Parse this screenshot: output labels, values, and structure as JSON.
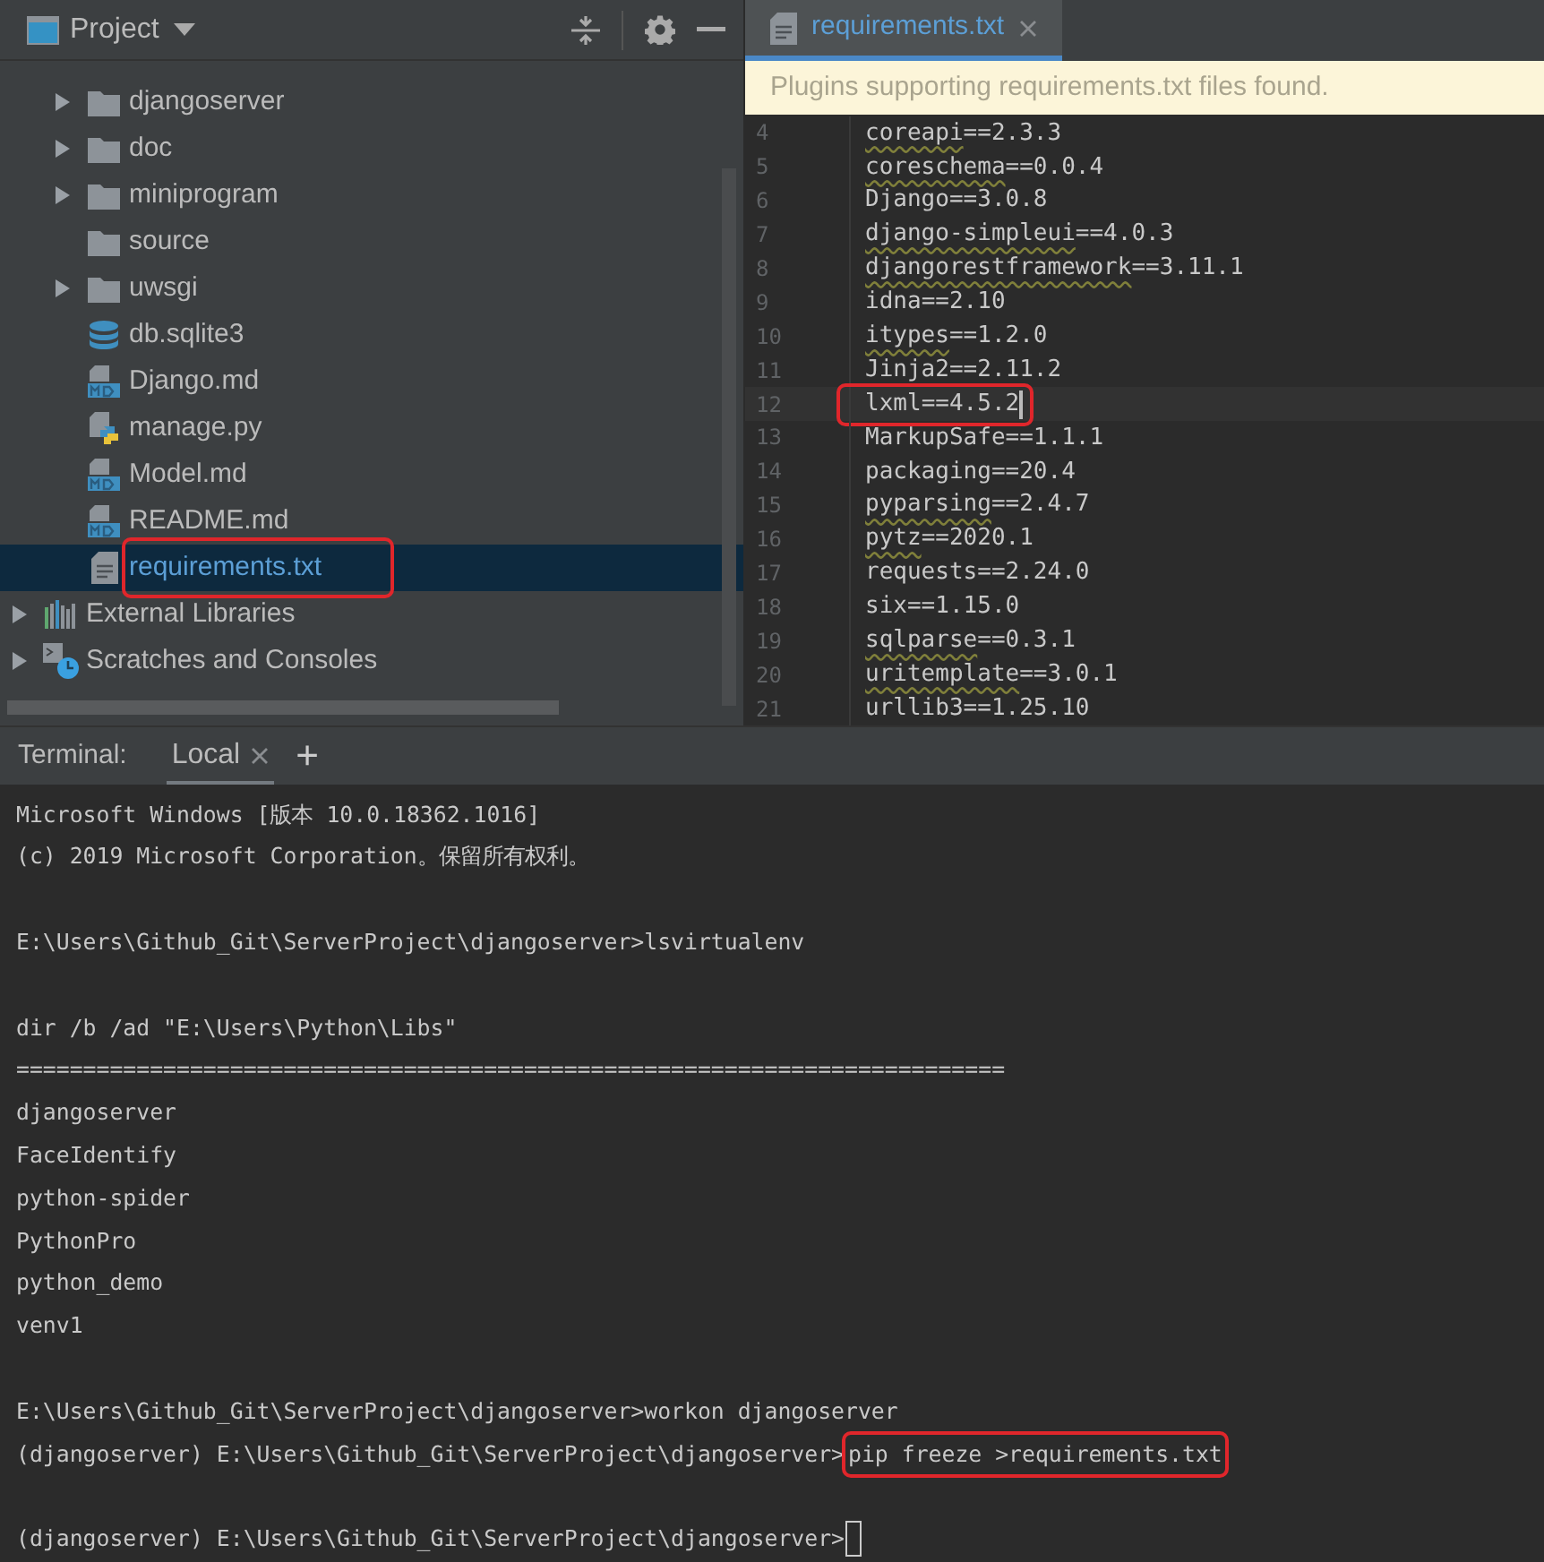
{
  "project_panel": {
    "title": "Project",
    "tree": [
      {
        "label": "djangoserver",
        "kind": "folder",
        "expanded": false,
        "selected": false,
        "outlined": false
      },
      {
        "label": "doc",
        "kind": "folder",
        "expanded": false,
        "selected": false,
        "outlined": false
      },
      {
        "label": "miniprogram",
        "kind": "folder",
        "expanded": false,
        "selected": false,
        "outlined": false
      },
      {
        "label": "source",
        "kind": "folder",
        "selected": false,
        "outlined": false
      },
      {
        "label": "uwsgi",
        "kind": "folder",
        "expanded": false,
        "selected": false,
        "outlined": false
      },
      {
        "label": "db.sqlite3",
        "kind": "database",
        "selected": false,
        "outlined": false
      },
      {
        "label": "Django.md",
        "kind": "markdown",
        "selected": false,
        "outlined": false
      },
      {
        "label": "manage.py",
        "kind": "python",
        "selected": false,
        "outlined": false
      },
      {
        "label": "Model.md",
        "kind": "markdown",
        "selected": false,
        "outlined": false
      },
      {
        "label": "README.md",
        "kind": "markdown",
        "selected": false,
        "outlined": false
      },
      {
        "label": "requirements.txt",
        "kind": "text",
        "selected": true,
        "outlined": true
      }
    ],
    "roots": [
      {
        "label": "External Libraries",
        "kind": "libraries",
        "expanded": false
      },
      {
        "label": "Scratches and Consoles",
        "kind": "scratches",
        "expanded": false
      }
    ]
  },
  "editor": {
    "tabs": [
      {
        "label": "requirements.txt",
        "selected": true
      }
    ],
    "banner": "Plugins supporting requirements.txt files found.",
    "lines": [
      {
        "number": "4",
        "text": "coreapi==2.3.3",
        "misspelled": true,
        "current": false
      },
      {
        "number": "5",
        "text": "coreschema==0.0.4",
        "misspelled": true,
        "current": false
      },
      {
        "number": "6",
        "text": "Django==3.0.8",
        "misspelled": false,
        "current": false
      },
      {
        "number": "7",
        "text": "django-simpleui==4.0.3",
        "misspelled": true,
        "current": false
      },
      {
        "number": "8",
        "text": "djangorestframework==3.11.1",
        "misspelled": true,
        "current": false
      },
      {
        "number": "9",
        "text": "idna==2.10",
        "misspelled": false,
        "current": false
      },
      {
        "number": "10",
        "text": "itypes==1.2.0",
        "misspelled": true,
        "current": false
      },
      {
        "number": "11",
        "text": "Jinja2==2.11.2",
        "misspelled": false,
        "current": false
      },
      {
        "number": "12",
        "text": "lxml==4.5.2",
        "misspelled": false,
        "current": true
      },
      {
        "number": "13",
        "text": "MarkupSafe==1.1.1",
        "misspelled": false,
        "current": false
      },
      {
        "number": "14",
        "text": "packaging==20.4",
        "misspelled": false,
        "current": false
      },
      {
        "number": "15",
        "text": "pyparsing==2.4.7",
        "misspelled": true,
        "current": false
      },
      {
        "number": "16",
        "text": "pytz==2020.1",
        "misspelled": true,
        "current": false
      },
      {
        "number": "17",
        "text": "requests==2.24.0",
        "misspelled": false,
        "current": false
      },
      {
        "number": "18",
        "text": "six==1.15.0",
        "misspelled": false,
        "current": false
      },
      {
        "number": "19",
        "text": "sqlparse==0.3.1",
        "misspelled": true,
        "current": false
      },
      {
        "number": "20",
        "text": "uritemplate==3.0.1",
        "misspelled": true,
        "current": false
      },
      {
        "number": "21",
        "text": "urllib3==1.25.10",
        "misspelled": false,
        "current": false
      }
    ]
  },
  "terminal": {
    "title": "Terminal:",
    "tabs": [
      {
        "label": "Local",
        "selected": true
      }
    ],
    "new_tab": "+",
    "lines": [
      {
        "kind": "text",
        "text": "Microsoft Windows [版本 10.0.18362.1016]"
      },
      {
        "kind": "text",
        "text": "(c) 2019 Microsoft Corporation。保留所有权利。"
      },
      {
        "kind": "blank"
      },
      {
        "kind": "text",
        "text": "E:\\Users\\Github_Git\\ServerProject\\djangoserver>lsvirtualenv"
      },
      {
        "kind": "blank"
      },
      {
        "kind": "text",
        "text": "dir /b /ad \"E:\\Users\\Python\\Libs\""
      },
      {
        "kind": "text",
        "text": "=========================================================================="
      },
      {
        "kind": "text",
        "text": "djangoserver"
      },
      {
        "kind": "text",
        "text": "FaceIdentify"
      },
      {
        "kind": "text",
        "text": "python-spider"
      },
      {
        "kind": "text",
        "text": "PythonPro"
      },
      {
        "kind": "text",
        "text": "python_demo"
      },
      {
        "kind": "text",
        "text": "venv1"
      },
      {
        "kind": "blank"
      },
      {
        "kind": "text",
        "text": "E:\\Users\\Github_Git\\ServerProject\\djangoserver>workon djangoserver"
      },
      {
        "kind": "command",
        "prompt": "(djangoserver) E:\\Users\\Github_Git\\ServerProject\\djangoserver>",
        "command": "pip freeze >requirements.txt",
        "outlined": true
      },
      {
        "kind": "blank"
      },
      {
        "kind": "prompt",
        "prompt": "(djangoserver) E:\\Users\\Github_Git\\ServerProject\\djangoserver>",
        "cursor": true
      }
    ]
  }
}
